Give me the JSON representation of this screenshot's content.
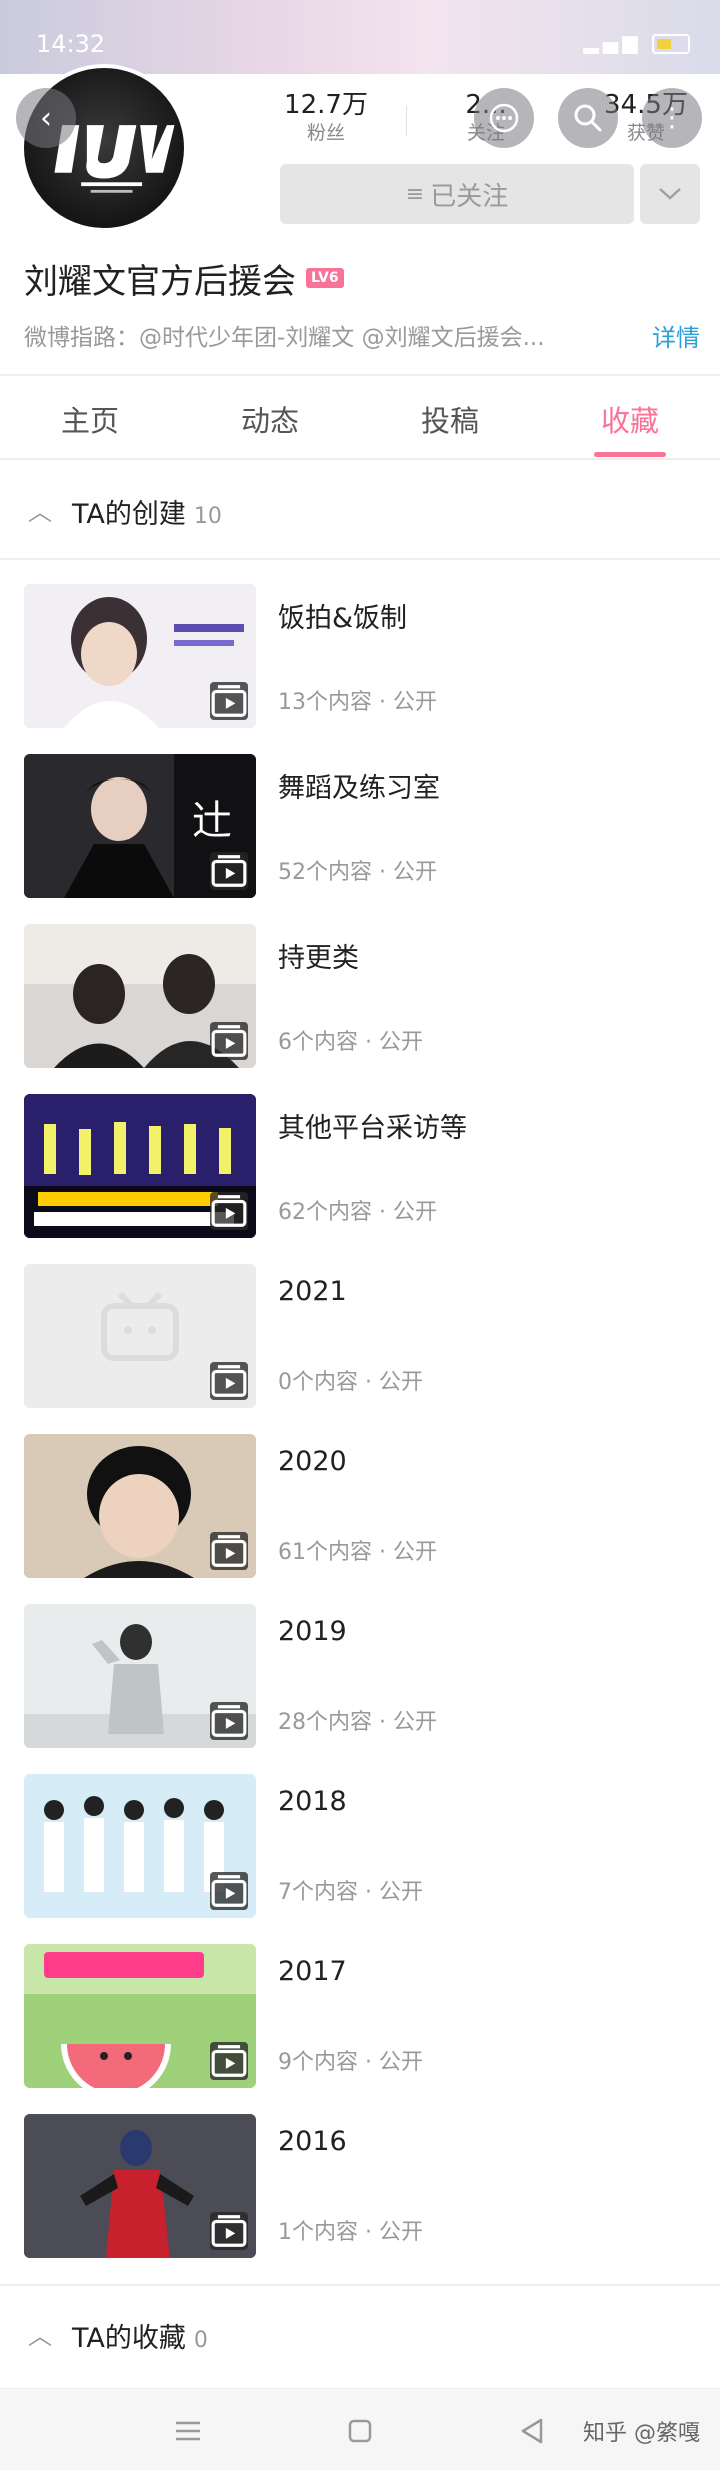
{
  "status_bar": {
    "time": "14:32"
  },
  "profile": {
    "name": "刘耀文官方后援会",
    "level_badge": "LV6",
    "bio": "微博指路：@时代少年团-刘耀文 @刘耀文后援会...",
    "detail_link": "详情",
    "follow_button": "已关注",
    "stats": {
      "fans_value": "12.7万",
      "fans_label": "粉丝",
      "follow_value": "2...",
      "follow_label": "关注",
      "likes_value": "34.5万",
      "likes_label": "获赞"
    }
  },
  "tabs": [
    {
      "label": "主页"
    },
    {
      "label": "动态"
    },
    {
      "label": "投稿"
    },
    {
      "label": "收藏"
    }
  ],
  "active_tab": "收藏",
  "created_section": {
    "title": "TA的创建",
    "count": "10"
  },
  "collections": [
    {
      "title": "饭拍&饭制",
      "meta": "13个内容 · 公开"
    },
    {
      "title": "舞蹈及练习室",
      "meta": "52个内容 · 公开"
    },
    {
      "title": "持更类",
      "meta": "6个内容 · 公开"
    },
    {
      "title": "其他平台采访等",
      "meta": "62个内容 · 公开"
    },
    {
      "title": "2021",
      "meta": "0个内容 · 公开"
    },
    {
      "title": "2020",
      "meta": "61个内容 · 公开"
    },
    {
      "title": "2019",
      "meta": "28个内容 · 公开"
    },
    {
      "title": "2018",
      "meta": "7个内容 · 公开"
    },
    {
      "title": "2017",
      "meta": "9个内容 · 公开"
    },
    {
      "title": "2016",
      "meta": "1个内容 · 公开"
    }
  ],
  "favorites_section": {
    "title": "TA的收藏",
    "count": "0"
  },
  "watermark": "知乎 @綮嘎",
  "colors": {
    "accent": "#fb7299",
    "link": "#2aa0d8",
    "muted": "#999999"
  }
}
